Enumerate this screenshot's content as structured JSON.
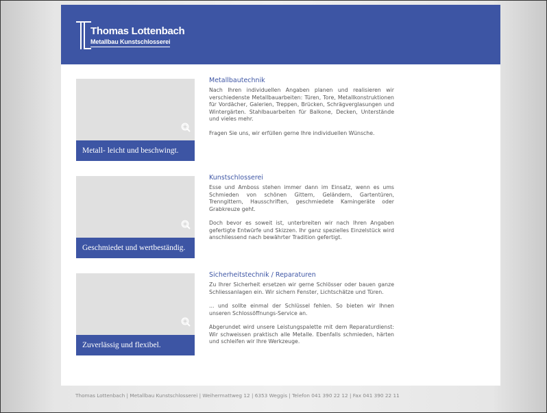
{
  "brand": {
    "name": "Thomas Lottenbach",
    "tagline": "Metallbau Kunstschlosserei"
  },
  "colors": {
    "accent": "#3d55a4",
    "thumbnail_bg": "#e0e0e0"
  },
  "icons": {
    "zoom": "zoom-in-icon"
  },
  "sections": [
    {
      "caption": "Metall- leicht und beschwingt.",
      "heading": "Metallbautechnik",
      "paragraphs": [
        "Nach Ihren individuellen Angaben planen und realisieren wir verschiedenste Metallbauarbeiten: Türen, Tore, Metallkonstruktionen für Vordächer, Galerien, Treppen, Brücken, Schrägverglasungen und Wintergärten. Stahlbauarbeiten für Balkone, Decken, Unterstände und vieles mehr.",
        "Fragen Sie uns, wir erfüllen gerne Ihre individuellen Wünsche."
      ]
    },
    {
      "caption": "Geschmiedet und wertbeständig.",
      "heading": "Kunstschlosserei",
      "paragraphs": [
        "Esse und Amboss stehen immer dann im Einsatz, wenn es ums Schmieden von schönen Gittern, Geländern, Gartentüren, Trenngittern, Hausschriften, geschmiedete Kamingeräte oder Grabkreuze geht.",
        "Doch bevor es soweit ist, unterbreiten wir nach Ihren Angaben gefertigte Entwürfe und Skizzen. Ihr ganz spezielles Einzelstück wird anschliessend nach bewährter Tradition gefertigt."
      ]
    },
    {
      "caption": "Zuverlässig und flexibel.",
      "heading": "Sicherheitstechnik / Reparaturen",
      "paragraphs": [
        "Zu Ihrer Sicherheit ersetzen wir gerne Schlösser oder bauen ganze Schliessanlagen ein. Wir sichern Fenster, Lichtschätze und Türen.",
        "... und sollte einmal der Schlüssel fehlen. So bieten wir Ihnen unseren Schlossöffnungs-Service an.",
        "Abgerundet wird unsere Leistungspalette mit dem Reparaturdienst: Wir schweissen praktisch alle Metalle. Ebenfalls schmieden, härten und schleifen wir Ihre Werkzeuge."
      ]
    }
  ],
  "footer": {
    "text": "Thomas Lottenbach | Metallbau Kunstschlosserei | Weihermattweg 12 | 6353 Weggis | Telefon 041 390 22 12 | Fax 041 390 22 11"
  }
}
